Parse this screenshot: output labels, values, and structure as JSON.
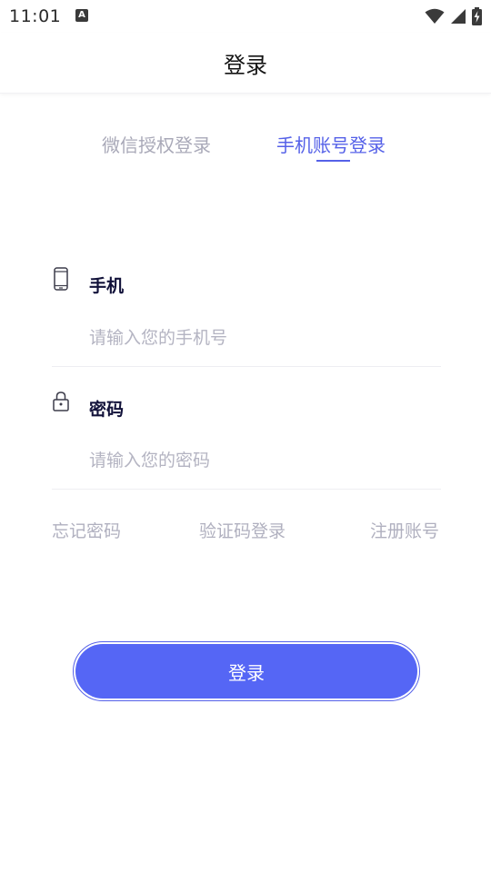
{
  "status_bar": {
    "time": "11:01",
    "notification_icon": "A",
    "icons": [
      "wifi-icon",
      "signal-icon",
      "battery-charging-icon"
    ]
  },
  "header": {
    "title": "登录"
  },
  "tabs": [
    {
      "label": "微信授权登录",
      "active": false
    },
    {
      "label": "手机账号登录",
      "active": true
    }
  ],
  "form": {
    "phone": {
      "label": "手机",
      "placeholder": "请输入您的手机号",
      "value": ""
    },
    "password": {
      "label": "密码",
      "placeholder": "请输入您的密码",
      "value": ""
    }
  },
  "links": {
    "forgot_password": "忘记密码",
    "code_login": "验证码登录",
    "register": "注册账号"
  },
  "login_button": {
    "label": "登录"
  },
  "colors": {
    "accent": "#5566f5",
    "tab_active": "#5561e8",
    "text_muted": "#b0b0bf",
    "label_dark": "#12123a"
  }
}
